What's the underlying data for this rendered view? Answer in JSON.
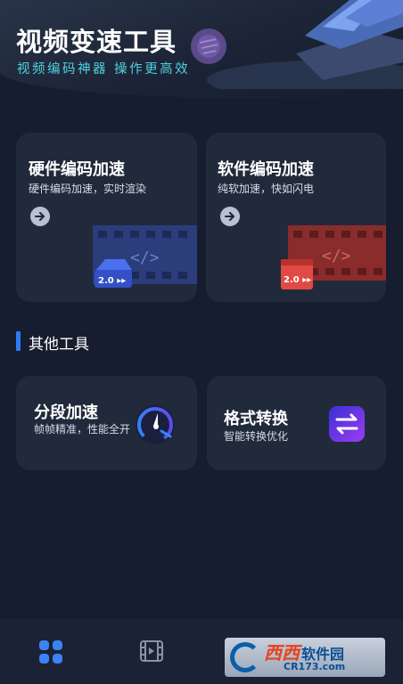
{
  "header": {
    "title": "视频变速工具",
    "subtitle": "视频编码神器  操作更高效"
  },
  "cards": [
    {
      "title": "硬件编码加速",
      "desc": "硬件编码加速，实时渲染",
      "badge": "2.0",
      "accent": "#3d5bd4"
    },
    {
      "title": "软件编码加速",
      "desc": "纯软加速，快如闪电",
      "badge": "2.0",
      "accent": "#d9453f"
    }
  ],
  "section": {
    "title": "其他工具"
  },
  "tools": [
    {
      "title": "分段加速",
      "desc": "帧帧精准，性能全开",
      "icon": "speedometer-icon"
    },
    {
      "title": "格式转换",
      "desc": "智能转换优化",
      "icon": "convert-icon"
    }
  ],
  "nav": [
    {
      "icon": "grid-icon",
      "active": true
    },
    {
      "icon": "film-icon",
      "active": false
    }
  ],
  "watermark": {
    "brand": "西西",
    "text": "软件园",
    "domain": "CR173.com"
  },
  "colors": {
    "background": "#151d2e",
    "card": "#212a3b",
    "accent_blue": "#2c7bf2",
    "subtitle_cyan": "#4fd0de"
  }
}
